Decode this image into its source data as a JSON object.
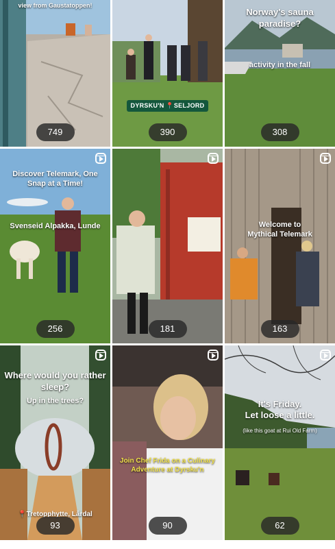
{
  "tiles": [
    {
      "caption": "view from Gaustatoppen!",
      "views": "749",
      "reel": false
    },
    {
      "caption": "DYRSKU'N 📍SELJORD",
      "views": "390",
      "reel": false
    },
    {
      "caption": "Norway's sauna paradise?",
      "subcaption": "activity in the fall",
      "views": "308",
      "reel": false
    },
    {
      "caption": "Discover Telemark, One Snap at a Time!",
      "subcaption": "Svenseid Alpakka, Lunde",
      "views": "256",
      "reel": true
    },
    {
      "caption": "",
      "views": "181",
      "reel": true
    },
    {
      "caption": "Welcome to",
      "subcaption": "Mythical Telemark",
      "views": "163",
      "reel": true
    },
    {
      "caption": "Where would you rather sleep?",
      "subcaption": "Up in the trees?",
      "location": "Tretopphytte, Lårdal",
      "views": "93",
      "reel": true
    },
    {
      "caption": "Join Chef Frida on a Culinary Adventure at Dyrsku'n",
      "views": "90",
      "reel": true
    },
    {
      "caption": "It's Friday.",
      "subcaption": "Let loose a little.",
      "note": "(like this goat at Rui Old Farm)",
      "views": "62",
      "reel": true
    }
  ]
}
